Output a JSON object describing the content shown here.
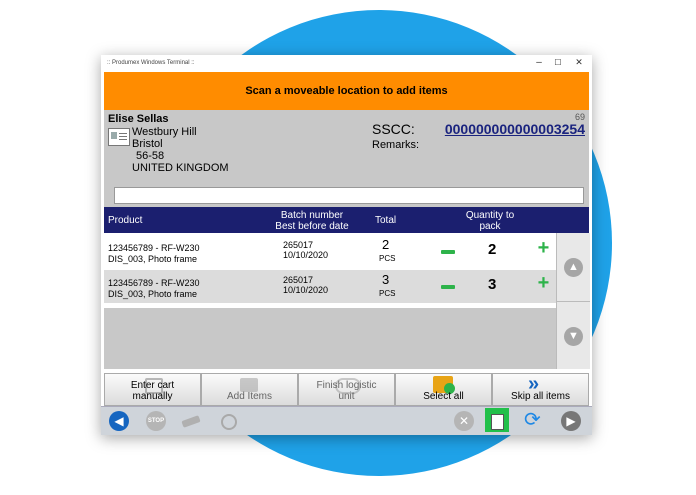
{
  "window": {
    "title": ":: Produmex Windows Terminal ::",
    "controls": {
      "minimize": "–",
      "maximize": "☐",
      "close": "✕"
    }
  },
  "banner": {
    "text": "Scan a moveable location to add items"
  },
  "customer": {
    "name": "Elise Sellas",
    "address": [
      "Westbury Hill",
      "Bristol",
      "56-58",
      "UNITED KINGDOM"
    ],
    "counter": "69"
  },
  "sscc": {
    "label": "SSCC:",
    "value": "000000000000003254"
  },
  "remarks": {
    "label": "Remarks:"
  },
  "scan": {
    "value": ""
  },
  "table": {
    "headers": {
      "product": "Product",
      "batch_line1": "Batch number",
      "batch_line2": "Best before date",
      "total": "Total",
      "qty_line1": "Quantity to",
      "qty_line2": "pack"
    },
    "rows": [
      {
        "code": "123456789 - RF-W230",
        "desc": "DIS_003, Photo frame",
        "batch": "265017",
        "bbd": "10/10/2020",
        "total": "2",
        "unit": "PCS",
        "qty": "2"
      },
      {
        "code": "123456789 - RF-W230",
        "desc": "DIS_003, Photo frame",
        "batch": "265017",
        "bbd": "10/10/2020",
        "total": "3",
        "unit": "PCS",
        "qty": "3"
      }
    ]
  },
  "actions": {
    "enter_cart_1": "Enter cart",
    "enter_cart_2": "manually",
    "add_items": "Add Items",
    "finish_lu_1": "Finish logistic",
    "finish_lu_2": "unit",
    "select_all": "Select all",
    "skip_all": "Skip all items"
  },
  "colors": {
    "banner": "#ff8c00",
    "header": "#1b1f6f",
    "accent_green": "#2db34a",
    "sscc": "#1a237e",
    "background_circle": "#1fa2e8"
  }
}
